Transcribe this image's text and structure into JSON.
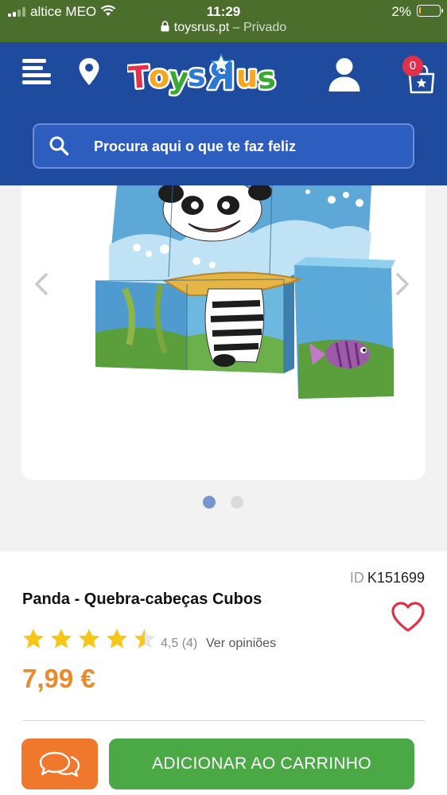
{
  "status_bar": {
    "carrier": "altice MEO",
    "time": "11:29",
    "battery": "2%",
    "url": "toysrus.pt",
    "url_suffix": "– Privado"
  },
  "header": {
    "logo_text": "ToysRus",
    "cart_count": "0",
    "search_placeholder": "Procura aqui o que te faz feliz"
  },
  "gallery": {
    "image_count": 2,
    "active_index": 1
  },
  "product": {
    "id_label": "ID",
    "id": "K151699",
    "title": "Panda - Quebra-cabeças Cubos",
    "rating_value": 4.5,
    "rating_text": "4,5 (4)",
    "opinions_link": "Ver opiniões",
    "price": "7,99 €"
  },
  "actions": {
    "add_to_cart": "ADICIONAR AO CARRINHO"
  },
  "colors": {
    "status_bar": "#4c6e2c",
    "header": "#1f4b9e",
    "price": "#e88a2e",
    "cart_button": "#4aa845",
    "chat_button": "#f0782d",
    "heart": "#e0304a"
  },
  "icons": [
    "menu-icon",
    "location-pin-icon",
    "user-icon",
    "shopping-bag-icon",
    "search-icon",
    "chevron-left-icon",
    "chevron-right-icon",
    "heart-icon",
    "star-icon",
    "chat-bubbles-icon"
  ]
}
